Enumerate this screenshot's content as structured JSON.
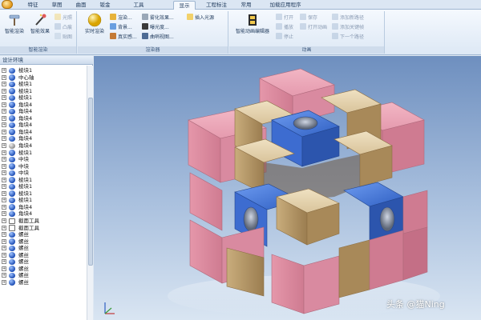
{
  "ribbon_tabs": [
    "特征",
    "草图",
    "曲面",
    "钣金",
    "工具",
    "显示",
    "工程标注",
    "常用",
    "加载应用程序"
  ],
  "active_tab": "显示",
  "groups": {
    "smart_render": {
      "label": "智能渲染",
      "buttons": [
        "智能渲染",
        "智能效果"
      ],
      "small": [
        "光照",
        "凸痕",
        "贴图"
      ]
    },
    "render": {
      "label": "渲染器",
      "big": "实时渲染",
      "small": [
        "渲染...",
        "背景...",
        "真实感...",
        "雾化效果...",
        "曝光度...",
        "曲哨视图...",
        "插入光源"
      ]
    },
    "animation": {
      "label": "动画",
      "big": "智能动画编辑器",
      "small": [
        "打开",
        "保存",
        "播放",
        "打开动画",
        "停止",
        "添加新路径",
        "添加关键帧",
        "下一个路径"
      ]
    }
  },
  "panel": {
    "title": "设计环境",
    "items": [
      {
        "label": "棱块1",
        "icon": "blue"
      },
      {
        "label": "中心轴",
        "icon": "blue"
      },
      {
        "label": "棱块1",
        "icon": "blue"
      },
      {
        "label": "棱块1",
        "icon": "blue"
      },
      {
        "label": "棱块1",
        "icon": "blue"
      },
      {
        "label": "角块4",
        "icon": "blue"
      },
      {
        "label": "角块4",
        "icon": "blue"
      },
      {
        "label": "角块4",
        "icon": "blue"
      },
      {
        "label": "角块4",
        "icon": "blue"
      },
      {
        "label": "角块4",
        "icon": "blue"
      },
      {
        "label": "角块4",
        "icon": "blue"
      },
      {
        "label": "角块4",
        "icon": "gray"
      },
      {
        "label": "棱块1",
        "icon": "blue"
      },
      {
        "label": "中块",
        "icon": "blue"
      },
      {
        "label": "中块",
        "icon": "blue"
      },
      {
        "label": "中块",
        "icon": "blue"
      },
      {
        "label": "棱块1",
        "icon": "blue"
      },
      {
        "label": "棱块1",
        "icon": "blue"
      },
      {
        "label": "棱块1",
        "icon": "blue"
      },
      {
        "label": "棱块1",
        "icon": "blue"
      },
      {
        "label": "角块4",
        "icon": "blue"
      },
      {
        "label": "角块4",
        "icon": "blue"
      },
      {
        "label": "截面工具",
        "icon": "tool"
      },
      {
        "label": "截面工具",
        "icon": "tool"
      },
      {
        "label": "螺丝",
        "icon": "blue"
      },
      {
        "label": "螺丝",
        "icon": "blue"
      },
      {
        "label": "螺丝",
        "icon": "blue"
      },
      {
        "label": "螺丝",
        "icon": "blue"
      },
      {
        "label": "螺丝",
        "icon": "blue"
      },
      {
        "label": "螺丝",
        "icon": "blue"
      },
      {
        "label": "螺丝",
        "icon": "blue"
      },
      {
        "label": "螺丝",
        "icon": "blue"
      }
    ]
  },
  "watermark": "头条 @猫Ning",
  "colors": {
    "edge_piece": "#e8a3b3",
    "corner_piece": "#e2cfa8",
    "center_piece": "#4d7fd8"
  }
}
